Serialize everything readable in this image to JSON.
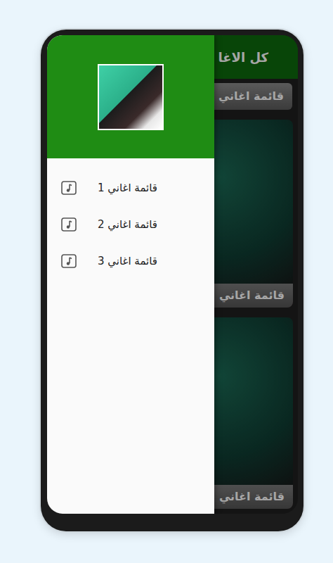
{
  "app_bar": {
    "title": "كل الاغا"
  },
  "list_button": {
    "label": "قائمة اغاني"
  },
  "cards": [
    {
      "caption": "قائمة اغاني"
    },
    {
      "caption": "قائمة اغاني"
    }
  ],
  "drawer": {
    "open": true,
    "items": [
      {
        "label": "قائمة اغاني 1"
      },
      {
        "label": "قائمة اغاني 2"
      },
      {
        "label": "قائمة اغاني 3"
      }
    ]
  }
}
